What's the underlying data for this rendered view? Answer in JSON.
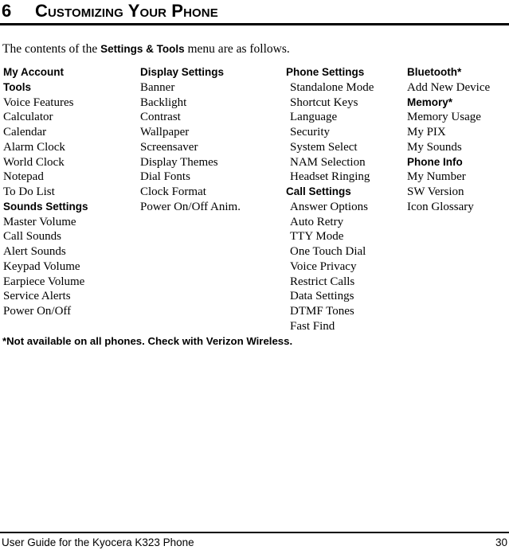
{
  "header": {
    "chapter_number": "6",
    "chapter_title": "Customizing Your Phone"
  },
  "intro": {
    "prefix": "The contents of the ",
    "emphasis": "Settings & Tools",
    "suffix": " menu are as follows."
  },
  "menu_columns": [
    {
      "column_name": "my-account-tools-sounds",
      "entries": [
        {
          "label": "My Account",
          "type": "heading"
        },
        {
          "label": "Tools",
          "type": "heading"
        },
        {
          "label": "Voice Features",
          "type": "item"
        },
        {
          "label": "Calculator",
          "type": "item"
        },
        {
          "label": "Calendar",
          "type": "item"
        },
        {
          "label": "Alarm Clock",
          "type": "item"
        },
        {
          "label": "World Clock",
          "type": "item"
        },
        {
          "label": "Notepad",
          "type": "item"
        },
        {
          "label": "To Do List",
          "type": "item"
        },
        {
          "label": "Sounds Settings",
          "type": "heading"
        },
        {
          "label": "Master Volume",
          "type": "item"
        },
        {
          "label": "Call Sounds",
          "type": "item"
        },
        {
          "label": "Alert Sounds",
          "type": "item"
        },
        {
          "label": "Keypad Volume",
          "type": "item"
        },
        {
          "label": "Earpiece Volume",
          "type": "item"
        },
        {
          "label": "Service Alerts",
          "type": "item"
        },
        {
          "label": "Power On/Off",
          "type": "item"
        }
      ]
    },
    {
      "column_name": "display-settings",
      "entries": [
        {
          "label": "Display Settings",
          "type": "heading"
        },
        {
          "label": "Banner",
          "type": "item"
        },
        {
          "label": "Backlight",
          "type": "item"
        },
        {
          "label": "Contrast",
          "type": "item"
        },
        {
          "label": "Wallpaper",
          "type": "item"
        },
        {
          "label": "Screensaver",
          "type": "item"
        },
        {
          "label": "Display Themes",
          "type": "item"
        },
        {
          "label": "Dial Fonts",
          "type": "item"
        },
        {
          "label": "Clock Format",
          "type": "item"
        },
        {
          "label": "Power On/Off Anim.",
          "type": "item"
        }
      ]
    },
    {
      "column_name": "phone-and-call-settings",
      "entries": [
        {
          "label": "Phone Settings",
          "type": "heading"
        },
        {
          "label": "Standalone Mode",
          "type": "item-indented"
        },
        {
          "label": "Shortcut Keys",
          "type": "item-indented"
        },
        {
          "label": "Language",
          "type": "item-indented"
        },
        {
          "label": "Security",
          "type": "item-indented"
        },
        {
          "label": "System Select",
          "type": "item-indented"
        },
        {
          "label": "NAM Selection",
          "type": "item-indented"
        },
        {
          "label": "Headset Ringing",
          "type": "item-indented"
        },
        {
          "label": "Call Settings",
          "type": "heading"
        },
        {
          "label": "Answer Options",
          "type": "item-indented"
        },
        {
          "label": "Auto Retry",
          "type": "item-indented"
        },
        {
          "label": "TTY Mode",
          "type": "item-indented"
        },
        {
          "label": "One Touch Dial",
          "type": "item-indented"
        },
        {
          "label": "Voice Privacy",
          "type": "item-indented"
        },
        {
          "label": "Restrict Calls",
          "type": "item-indented"
        },
        {
          "label": "Data Settings",
          "type": "item-indented"
        },
        {
          "label": "DTMF Tones",
          "type": "item-indented"
        },
        {
          "label": "Fast Find",
          "type": "item-indented"
        }
      ]
    },
    {
      "column_name": "bluetooth-memory-phone-info",
      "entries": [
        {
          "label": "Bluetooth*",
          "type": "heading"
        },
        {
          "label": "Add New Device",
          "type": "item"
        },
        {
          "label": "Memory*",
          "type": "heading"
        },
        {
          "label": "Memory Usage",
          "type": "item"
        },
        {
          "label": "My PIX",
          "type": "item"
        },
        {
          "label": "My Sounds",
          "type": "item"
        },
        {
          "label": "Phone Info",
          "type": "heading"
        },
        {
          "label": "My Number",
          "type": "item"
        },
        {
          "label": "SW Version",
          "type": "item"
        },
        {
          "label": "Icon Glossary",
          "type": "item"
        }
      ]
    }
  ],
  "footnote": "*Not available on all phones. Check with Verizon Wireless.",
  "footer": {
    "title": "User Guide for the Kyocera K323 Phone",
    "page_number": "30"
  }
}
